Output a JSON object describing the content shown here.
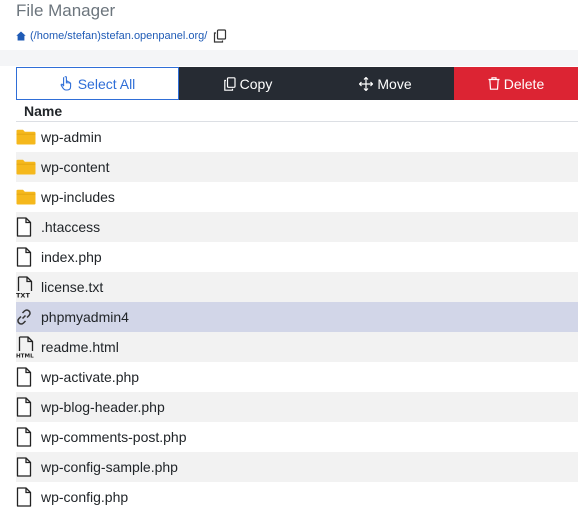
{
  "header": {
    "title": "File Manager",
    "path": "(/home/stefan)stefan.openpanel.org/"
  },
  "toolbar": {
    "select_all": "Select All",
    "copy": "Copy",
    "move": "Move",
    "delete": "Delete"
  },
  "table": {
    "name_header": "Name",
    "rows": [
      {
        "name": "wp-admin",
        "icon": "folder-icon"
      },
      {
        "name": "wp-content",
        "icon": "folder-icon"
      },
      {
        "name": "wp-includes",
        "icon": "folder-icon"
      },
      {
        "name": ".htaccess",
        "icon": "file-icon"
      },
      {
        "name": "index.php",
        "icon": "file-icon"
      },
      {
        "name": "license.txt",
        "icon": "txt-file-icon"
      },
      {
        "name": "phpmyadmin4",
        "icon": "link-icon",
        "selected": true
      },
      {
        "name": "readme.html",
        "icon": "html-file-icon"
      },
      {
        "name": "wp-activate.php",
        "icon": "file-icon"
      },
      {
        "name": "wp-blog-header.php",
        "icon": "file-icon"
      },
      {
        "name": "wp-comments-post.php",
        "icon": "file-icon"
      },
      {
        "name": "wp-config-sample.php",
        "icon": "file-icon"
      },
      {
        "name": "wp-config.php",
        "icon": "file-icon"
      }
    ]
  },
  "colors": {
    "accent": "#2f6ed7",
    "dark_button": "#262b33",
    "danger": "#dc2433",
    "folder": "#f5b81c",
    "selected_row": "#d2d6e8"
  }
}
